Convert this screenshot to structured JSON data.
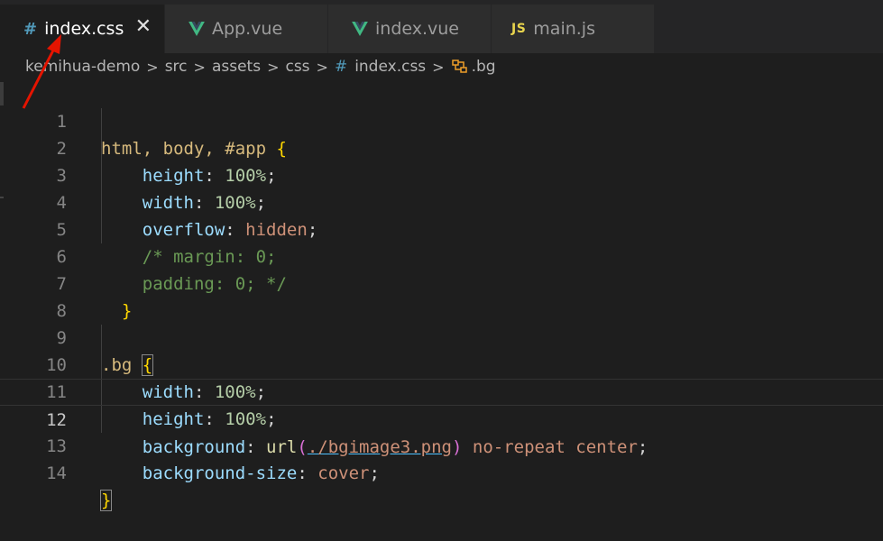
{
  "tabs": [
    {
      "label": "index.css",
      "icon": "hash-icon",
      "active": true
    },
    {
      "label": "App.vue",
      "icon": "vue-icon",
      "active": false
    },
    {
      "label": "index.vue",
      "icon": "vue-icon",
      "active": false
    },
    {
      "label": "main.js",
      "icon": "js-icon",
      "active": false
    }
  ],
  "tab_close": "✕",
  "breadcrumb": {
    "items": [
      "kemihua-demo",
      "src",
      "assets",
      "css",
      "index.css",
      ".bg"
    ],
    "separator": ">"
  },
  "code": {
    "current_line": 12,
    "lines": [
      {
        "n": "1"
      },
      {
        "n": "2"
      },
      {
        "n": "3"
      },
      {
        "n": "4"
      },
      {
        "n": "5"
      },
      {
        "n": "6"
      },
      {
        "n": "7"
      },
      {
        "n": "8"
      },
      {
        "n": "9"
      },
      {
        "n": "10"
      },
      {
        "n": "11"
      },
      {
        "n": "12"
      },
      {
        "n": "13"
      },
      {
        "n": "14"
      }
    ],
    "tokens": {
      "l1_sel": "html, body, #app",
      "l1_brace": "{",
      "l2_prop": "height",
      "l2_val": "100%",
      "l3_prop": "width",
      "l3_val": "100%",
      "l4_prop": "overflow",
      "l4_val": "hidden",
      "l5_cmt": "/* margin: 0;",
      "l6_cmt": "padding: 0; */",
      "l7_brace": "}",
      "l9_sel": ".bg",
      "l9_brace": "{",
      "l10_prop": "width",
      "l10_val": "100%",
      "l11_prop": "height",
      "l11_val": "100%",
      "l12_prop": "background",
      "l12_fn": "url",
      "l12_url": "./bgimage3.png",
      "l12_rest": "no-repeat center",
      "l13_prop": "background-size",
      "l13_val": "cover",
      "l14_brace": "}"
    }
  },
  "colors": {
    "background": "#1e1e1e",
    "selector": "#d7ba7d",
    "property": "#9cdcfe",
    "number": "#b5cea8",
    "value": "#ce9178",
    "comment": "#6a9955",
    "brace": "#ffd700",
    "annotation_arrow": "#e51400"
  }
}
